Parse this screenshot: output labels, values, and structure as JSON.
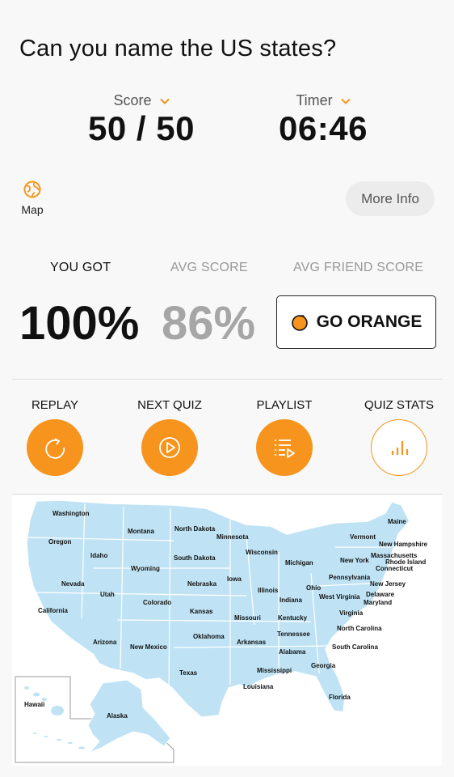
{
  "header": {
    "title": "Can you name the US states?"
  },
  "score": {
    "label": "Score",
    "value": "50 / 50"
  },
  "timer": {
    "label": "Timer",
    "value": "06:46"
  },
  "map_toggle": {
    "label": "Map",
    "icon": "globe-icon"
  },
  "more_info": {
    "label": "More Info"
  },
  "results": {
    "you_got_label": "YOU GOT",
    "you_got_value": "100%",
    "avg_label": "AVG SCORE",
    "avg_value": "86%",
    "friend_label": "AVG FRIEND SCORE",
    "go_orange_label": "GO ORANGE"
  },
  "actions": [
    {
      "label": "REPLAY",
      "icon": "replay-icon"
    },
    {
      "label": "NEXT QUIZ",
      "icon": "play-icon"
    },
    {
      "label": "PLAYLIST",
      "icon": "playlist-icon"
    },
    {
      "label": "QUIZ STATS",
      "icon": "bar-chart-icon"
    }
  ],
  "map": {
    "states": {
      "washington": "Washington",
      "oregon": "Oregon",
      "california": "California",
      "idaho": "Idaho",
      "nevada": "Nevada",
      "montana": "Montana",
      "wyoming": "Wyoming",
      "utah": "Utah",
      "arizona": "Arizona",
      "colorado": "Colorado",
      "new_mexico": "New Mexico",
      "north_dakota": "North Dakota",
      "south_dakota": "South Dakota",
      "nebraska": "Nebraska",
      "kansas": "Kansas",
      "oklahoma": "Oklahoma",
      "texas": "Texas",
      "minnesota": "Minnesota",
      "iowa": "Iowa",
      "missouri": "Missouri",
      "arkansas": "Arkansas",
      "louisiana": "Louisiana",
      "wisconsin": "Wisconsin",
      "illinois": "Illinois",
      "michigan": "Michigan",
      "indiana": "Indiana",
      "ohio": "Ohio",
      "kentucky": "Kentucky",
      "tennessee": "Tennessee",
      "mississippi": "Mississippi",
      "alabama": "Alabama",
      "georgia": "Georgia",
      "florida": "Florida",
      "south_carolina": "South Carolina",
      "north_carolina": "North Carolina",
      "virginia": "Virginia",
      "west_virginia": "West Virginia",
      "maryland": "Maryland",
      "delaware": "Delaware",
      "new_jersey": "New Jersey",
      "pennsylvania": "Pennsylvania",
      "new_york": "New York",
      "connecticut": "Connecticut",
      "rhode_island": "Rhode Island",
      "massachusetts": "Massachusetts",
      "vermont": "Vermont",
      "new_hampshire": "New Hampshire",
      "maine": "Maine",
      "hawaii": "Hawaii",
      "alaska": "Alaska"
    },
    "colors": {
      "land": "#bfe3f5",
      "border": "#ffffff"
    }
  },
  "colors": {
    "accent": "#f7941d",
    "muted": "#a6a6a6"
  }
}
